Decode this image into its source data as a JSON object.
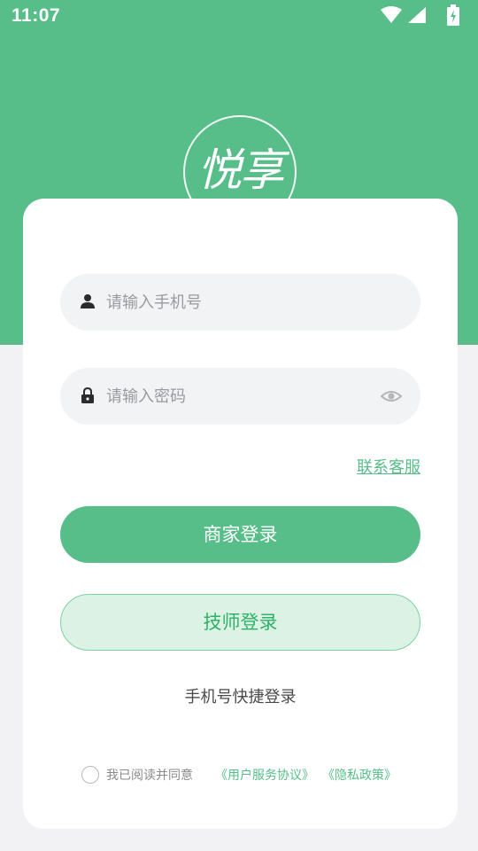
{
  "status_bar": {
    "time": "11:07"
  },
  "logo": {
    "text": "悦享"
  },
  "login": {
    "phone_placeholder": "请输入手机号",
    "password_placeholder": "请输入密码",
    "contact_service": "联系客服",
    "merchant_login": "商家登录",
    "technician_login": "技师登录",
    "quick_login": "手机号快捷登录"
  },
  "agreement": {
    "prefix": "我已阅读并同意",
    "user_agreement": "《用户服务协议》",
    "privacy_policy": "《隐私政策》"
  },
  "colors": {
    "brand": "#57bd89",
    "tech_button_bg": "#dcf2e4",
    "tech_text": "#2fb268",
    "background": "#f2f2f4"
  },
  "icons": [
    "wifi-icon",
    "signal-icon",
    "battery-icon",
    "user-icon",
    "lock-icon",
    "eye-icon"
  ]
}
